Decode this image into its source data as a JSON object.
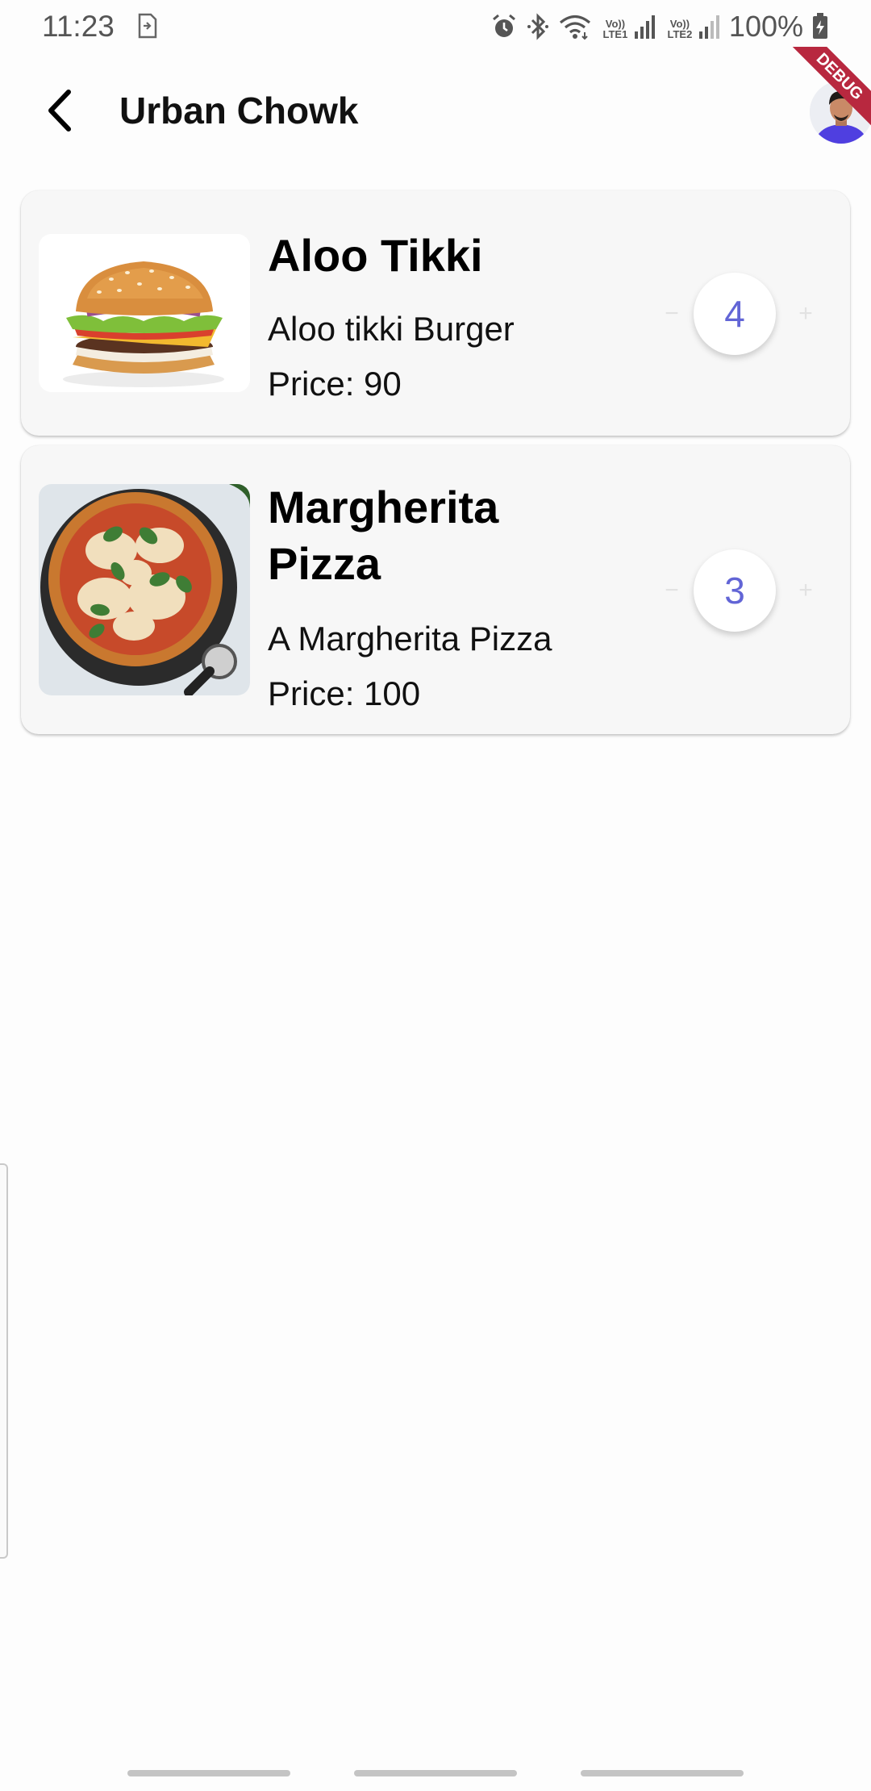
{
  "status_bar": {
    "time": "11:23",
    "battery": "100%",
    "sim1": "Vo)) LTE1",
    "sim2": "Vo)) LTE2",
    "icons": [
      "sim-card-icon",
      "alarm-icon",
      "bluetooth-icon",
      "wifi-icon",
      "signal-icon",
      "battery-charging-icon"
    ]
  },
  "app_bar": {
    "title": "Urban Chowk",
    "back_icon": "arrow-back-icon",
    "avatar": "user-avatar",
    "debug_banner": "DEBUG"
  },
  "items": [
    {
      "name": "Aloo Tikki",
      "description": "Aloo tikki Burger",
      "price": "Price: 90",
      "quantity": "4",
      "minus": "−",
      "plus": "+",
      "image": "burger-image"
    },
    {
      "name": "Margherita Pizza",
      "description": "A Margherita Pizza",
      "price": "Price: 100",
      "quantity": "3",
      "minus": "−",
      "plus": "+",
      "image": "pizza-image"
    }
  ],
  "colors": {
    "accent": "#6265d6",
    "card_bg": "#f7f7f7",
    "debug_ribbon": "#b8283f"
  }
}
